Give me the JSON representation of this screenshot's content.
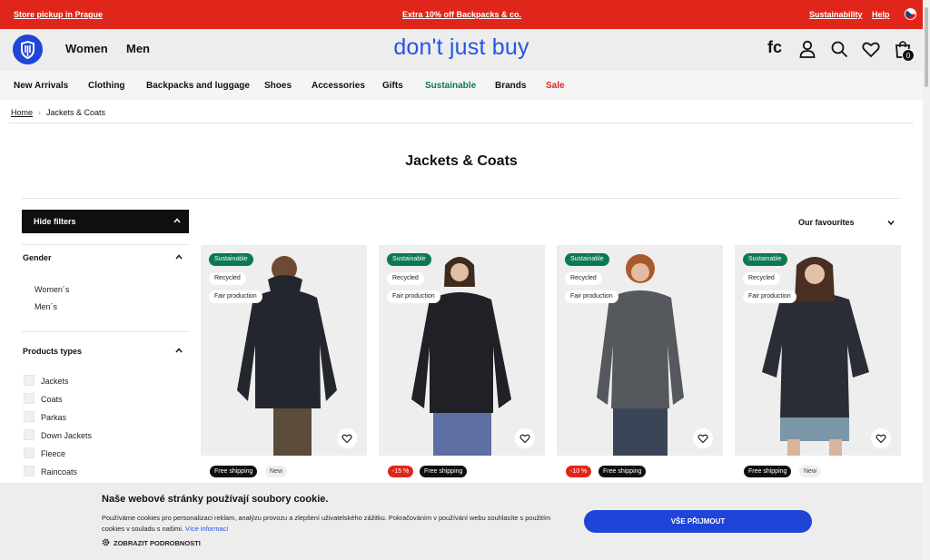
{
  "topbar": {
    "store_pickup": "Store pickup in Prague",
    "promo": "Extra 10% off Backpacks & co.",
    "sustainability": "Sustainability",
    "help": "Help",
    "flag": "czech-flag-icon"
  },
  "header": {
    "nav": [
      "Women",
      "Men"
    ],
    "slogan": "don't just buy",
    "fc_label": "fc",
    "cart_count": "0",
    "accent_color": "#2652e6"
  },
  "categories": [
    {
      "label": "New Arrivals"
    },
    {
      "label": "Clothing"
    },
    {
      "label": "Backpacks and luggage"
    },
    {
      "label": "Shoes"
    },
    {
      "label": "Accessories"
    },
    {
      "label": "Gifts"
    },
    {
      "label": "Sustainable",
      "color": "#0b7a51"
    },
    {
      "label": "Brands"
    },
    {
      "label": "Sale",
      "color": "#e0261a"
    }
  ],
  "breadcrumb": {
    "home": "Home",
    "current": "Jackets & Coats"
  },
  "page_title": "Jackets & Coats",
  "filters": {
    "hide_label": "Hide filters",
    "gender": {
      "title": "Gender",
      "options": [
        "Women´s",
        "Men´s"
      ]
    },
    "product_types": {
      "title": "Products types",
      "options": [
        "Jackets",
        "Coats",
        "Parkas",
        "Down Jackets",
        "Fleece",
        "Raincoats"
      ]
    }
  },
  "sort": {
    "selected": "Our favourites"
  },
  "products": [
    {
      "badges": [
        "Sustainable",
        "Recycled",
        "Fair production"
      ],
      "tags": [
        {
          "text": "Free shipping",
          "kind": "ship"
        },
        {
          "text": "New",
          "kind": "new"
        }
      ],
      "jacket_color": "#23262d",
      "pants_color": "#5a4c39"
    },
    {
      "badges": [
        "Sustainable",
        "Recycled",
        "Fair production"
      ],
      "tags": [
        {
          "text": "-15 %",
          "kind": "disc"
        },
        {
          "text": "Free shipping",
          "kind": "ship"
        }
      ],
      "jacket_color": "#1f2126",
      "pants_color": "#5d6fa3"
    },
    {
      "badges": [
        "Sustainable",
        "Recycled",
        "Fair production"
      ],
      "tags": [
        {
          "text": "-10 %",
          "kind": "disc"
        },
        {
          "text": "Free shipping",
          "kind": "ship"
        }
      ],
      "jacket_color": "#55585c",
      "pants_color": "#3a4558"
    },
    {
      "badges": [
        "Sustainable",
        "Recycled",
        "Fair production"
      ],
      "tags": [
        {
          "text": "Free shipping",
          "kind": "ship"
        },
        {
          "text": "New",
          "kind": "new"
        }
      ],
      "jacket_color": "#2b2d36",
      "pants_color": "#7b96a6"
    }
  ],
  "cookie": {
    "title": "Naše webové stránky používají soubory cookie.",
    "text": "Používáme cookies pro personalizaci reklam, analýzu provozu a zlepšení uživatelského zážitku. Pokračováním v používání webu souhlasíte s použitím cookies v souladu s našimi.",
    "more": "Více informací",
    "details": "ZOBRAZIT PODROBNOSTI",
    "accept": "VŠE PŘIJMOUT"
  }
}
